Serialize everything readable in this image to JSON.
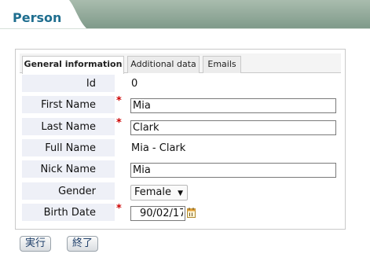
{
  "page": {
    "title": "Person"
  },
  "tabs": [
    {
      "label": "General information",
      "active": true
    },
    {
      "label": "Additional data",
      "active": false
    },
    {
      "label": "Emails",
      "active": false
    }
  ],
  "form": {
    "id": {
      "label": "Id",
      "value": "0"
    },
    "first_name": {
      "label": "First Name",
      "value": "Mia",
      "required": true
    },
    "last_name": {
      "label": "Last Name",
      "value": "Clark",
      "required": true
    },
    "full_name": {
      "label": "Full Name",
      "value": "Mia - Clark"
    },
    "nick_name": {
      "label": "Nick Name",
      "value": "Mia"
    },
    "gender": {
      "label": "Gender",
      "value": "Female"
    },
    "birth_date": {
      "label": "Birth Date",
      "value": "90/02/17",
      "required": true
    },
    "required_marker": "*"
  },
  "buttons": {
    "execute": "実行",
    "close": "終了"
  },
  "icons": {
    "calendar": "calendar-icon",
    "dropdown": "chevron-down-icon"
  },
  "colors": {
    "header": "#8aa596",
    "title": "#1f6e8f",
    "label_bg": "#eef0f7",
    "required": "#cc0000"
  }
}
